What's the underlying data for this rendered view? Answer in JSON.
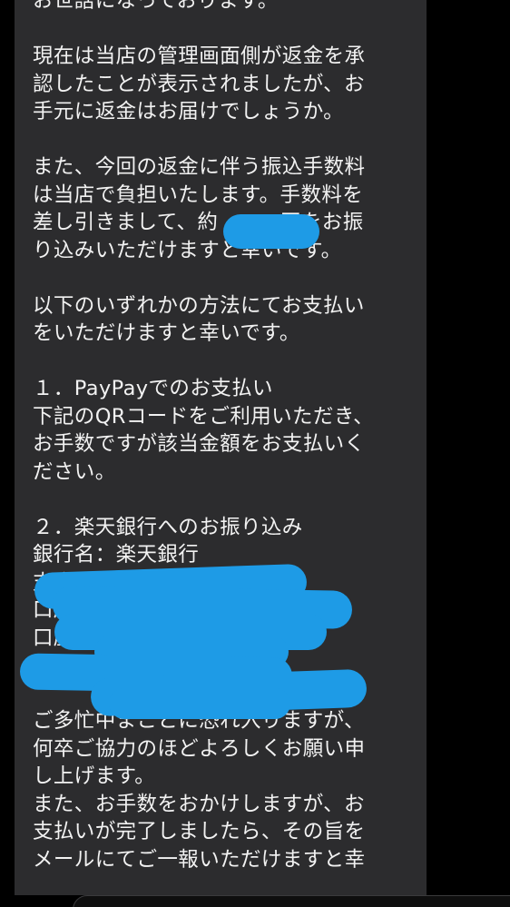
{
  "message": {
    "lines": [
      "お世話になっております。",
      "",
      "現在は当店の管理画面側が返金を承",
      "認したことが表示されましたが、お",
      "手元に返金はお届けでしょうか。",
      "",
      "また、今回の返金に伴う振込手数料",
      "は当店で負担いたします。手数料を",
      "差し引きまして、約　　　円をお振",
      "り込みいただけますと幸いです。",
      "",
      "以下のいずれかの方法にてお支払い",
      "をいただけますと幸いです。",
      "",
      "１．PayPayでのお支払い",
      "下記のQRコードをご利用いただき、",
      "お手数ですが該当金額をお支払いく",
      "ださい。",
      "",
      "２．楽天銀行へのお振り込み",
      "銀行名：楽天銀行",
      "支店名：",
      "口座種別：",
      "口座番号：",
      "名義人：",
      "",
      "ご多忙中まことに恐れ入りますが、",
      "何卒ご協力のほどよろしくお願い申",
      "し上げます。",
      "また、お手数をおかけしますが、お",
      "支払いが完了しましたら、その旨を",
      "メールにてご一報いただけますと幸"
    ]
  },
  "colors": {
    "background": "#000000",
    "bubble": "#2c2c2e",
    "text": "#f2f2f2",
    "redaction": "#1e9be6"
  }
}
